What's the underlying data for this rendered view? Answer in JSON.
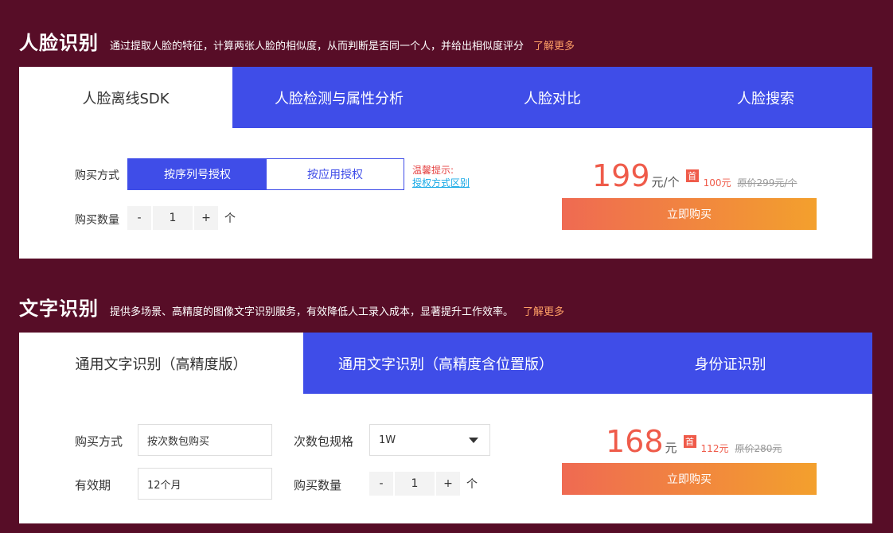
{
  "face": {
    "title": "人脸识别",
    "desc": "通过提取人脸的特征，计算两张人脸的相似度，从而判断是否同一个人，并给出相似度评分",
    "learn_more": "了解更多",
    "tabs": [
      "人脸离线SDK",
      "人脸检测与属性分析",
      "人脸对比",
      "人脸搜索"
    ],
    "purchase_mode_label": "购买方式",
    "mode_options": [
      "按序列号授权",
      "按应用授权"
    ],
    "tip_warn": "温馨提示:",
    "tip_link": "授权方式区别",
    "quantity_label": "购买数量",
    "quantity": {
      "minus": "-",
      "value": "1",
      "plus": "+",
      "unit": "个"
    },
    "price": "199",
    "price_unit": "元/个",
    "badge": "首",
    "discount": "100元",
    "original": "原价299元/个",
    "buy": "立即购买"
  },
  "ocr": {
    "title": "文字识别",
    "desc": "提供多场景、高精度的图像文字识别服务，有效降低人工录入成本，显著提升工作效率。",
    "learn_more": "了解更多",
    "tabs": [
      "通用文字识别（高精度版）",
      "通用文字识别（高精度含位置版）",
      "身份证识别"
    ],
    "purchase_mode_label": "购买方式",
    "purchase_mode_value": "按次数包购买",
    "package_label": "次数包规格",
    "package_value": "1W",
    "validity_label": "有效期",
    "validity_value": "12个月",
    "quantity_label": "购买数量",
    "quantity": {
      "minus": "-",
      "value": "1",
      "plus": "+",
      "unit": "个"
    },
    "price": "168",
    "price_unit": "元",
    "badge": "首",
    "discount": "112元",
    "original": "原价280元",
    "buy": "立即购买"
  },
  "colors": {
    "background": "#570d27",
    "accent": "#3f4de8",
    "price": "#ef5b4a",
    "learn_more": "#ff9f66"
  }
}
